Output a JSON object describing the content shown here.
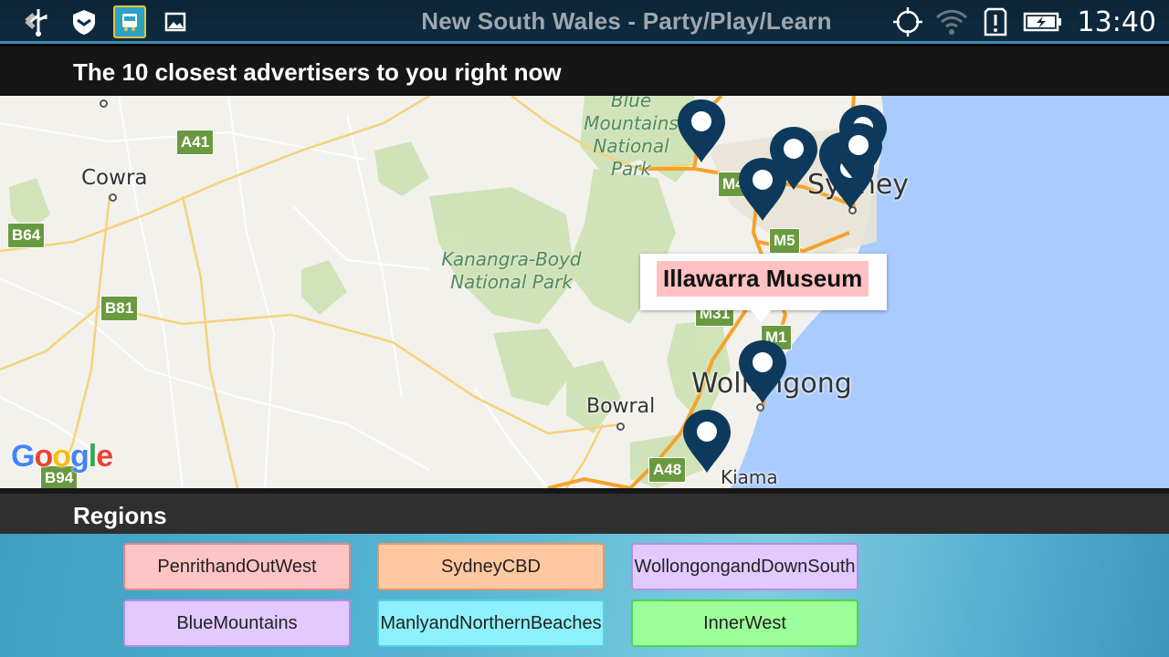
{
  "status_bar": {
    "title": "New South Wales - Party/Play/Learn",
    "time": "13:40",
    "left_icons": [
      "usb-icon",
      "shield-icon",
      "bus-app-icon",
      "gallery-icon"
    ],
    "right_icons": [
      "gps-icon",
      "wifi-icon",
      "alert-icon",
      "battery-icon"
    ]
  },
  "header": {
    "title": "The 10 closest advertisers to you right now"
  },
  "map": {
    "cities": [
      "Cowra",
      "Sydney",
      "Wollongong",
      "Bowral",
      "Kiama"
    ],
    "parks": [
      "Blue Mountains National Park",
      "Kanangra-Boyd National Park"
    ],
    "park_lines": {
      "blue": [
        "Blue",
        "Mountains",
        "National Park"
      ],
      "kanangra": [
        "Kanangra-Boyd",
        "National Park"
      ]
    },
    "routes": [
      "A41",
      "B64",
      "B81",
      "B94",
      "M4",
      "M5",
      "M31",
      "M1",
      "A48"
    ],
    "marker_count": 10,
    "popup": {
      "label": "Illawarra Museum"
    },
    "attribution": "Google",
    "colors": {
      "marker": "#0d3a5c",
      "water": "#a9cbff",
      "land": "#f3f1ec",
      "park": "#cfe3b6",
      "road_major": "#f4b53a"
    }
  },
  "regions": {
    "title": "Regions",
    "buttons": [
      {
        "label": "PenrithandOutWest",
        "bg": "#ffc4c4",
        "border": "#e08a8a"
      },
      {
        "label": "SydneyCBD",
        "bg": "#ffc8a0",
        "border": "#e59a62"
      },
      {
        "label": "WollongongandDownSouth",
        "bg": "#e2c9ff",
        "border": "#b98de6"
      },
      {
        "label": "BlueMountains",
        "bg": "#e2c9ff",
        "border": "#b98de6"
      },
      {
        "label": "ManlyandNorthernBeaches",
        "bg": "#8ef1fb",
        "border": "#4fd3e6"
      },
      {
        "label": "InnerWest",
        "bg": "#9dff9a",
        "border": "#4ed64a"
      }
    ]
  }
}
